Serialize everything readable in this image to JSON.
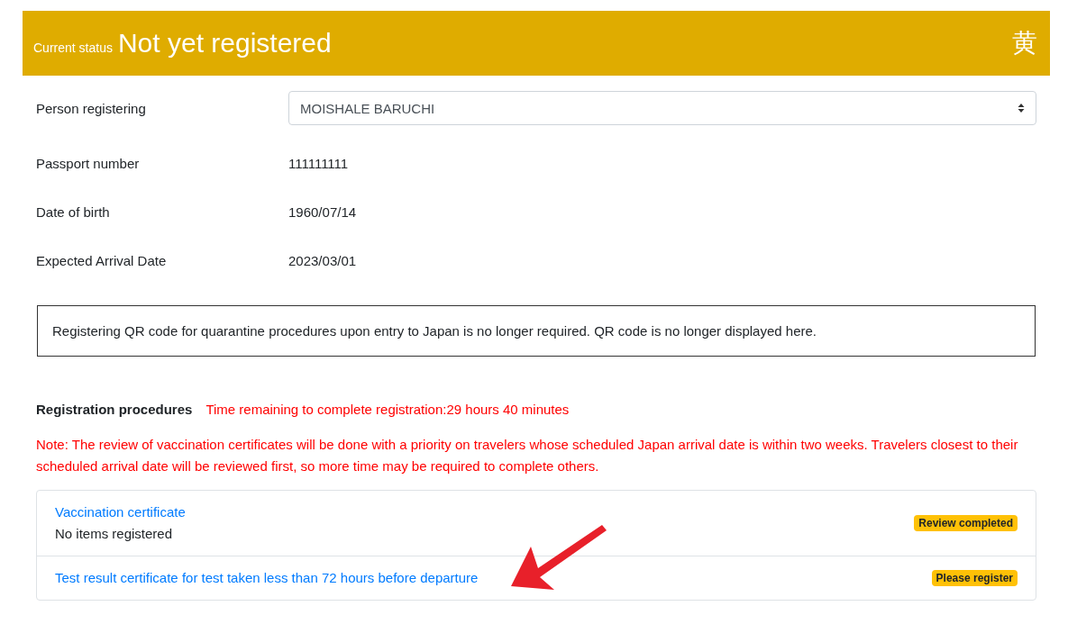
{
  "status_header": {
    "label": "Current status",
    "status": "Not yet registered",
    "badge_char": "黄"
  },
  "fields": [
    {
      "kind": "select",
      "label": "Person registering",
      "value": "MOISHALE BARUCHI"
    },
    {
      "kind": "text",
      "label": "Passport number",
      "value": "111111111"
    },
    {
      "kind": "text",
      "label": "Date of birth",
      "value": "1960/07/14"
    },
    {
      "kind": "text",
      "label": "Expected Arrival Date",
      "value": "2023/03/01"
    }
  ],
  "notice": "Registering QR code for quarantine procedures upon entry to Japan is no longer required. QR code is no longer displayed here.",
  "registration": {
    "title": "Registration procedures",
    "time_remaining": "Time remaining to complete registration:29 hours 40 minutes",
    "note": "Note: The review of vaccination certificates will be done with a priority on travelers whose scheduled Japan arrival date is within two weeks. Travelers closest to their scheduled arrival date will be reviewed first, so more time may be required to complete others.",
    "items": [
      {
        "title": "Vaccination certificate",
        "detail": "No items registered",
        "badge": "Review completed"
      },
      {
        "title": "Test result certificate for test taken less than 72 hours before departure",
        "badge": "Please register"
      }
    ]
  }
}
